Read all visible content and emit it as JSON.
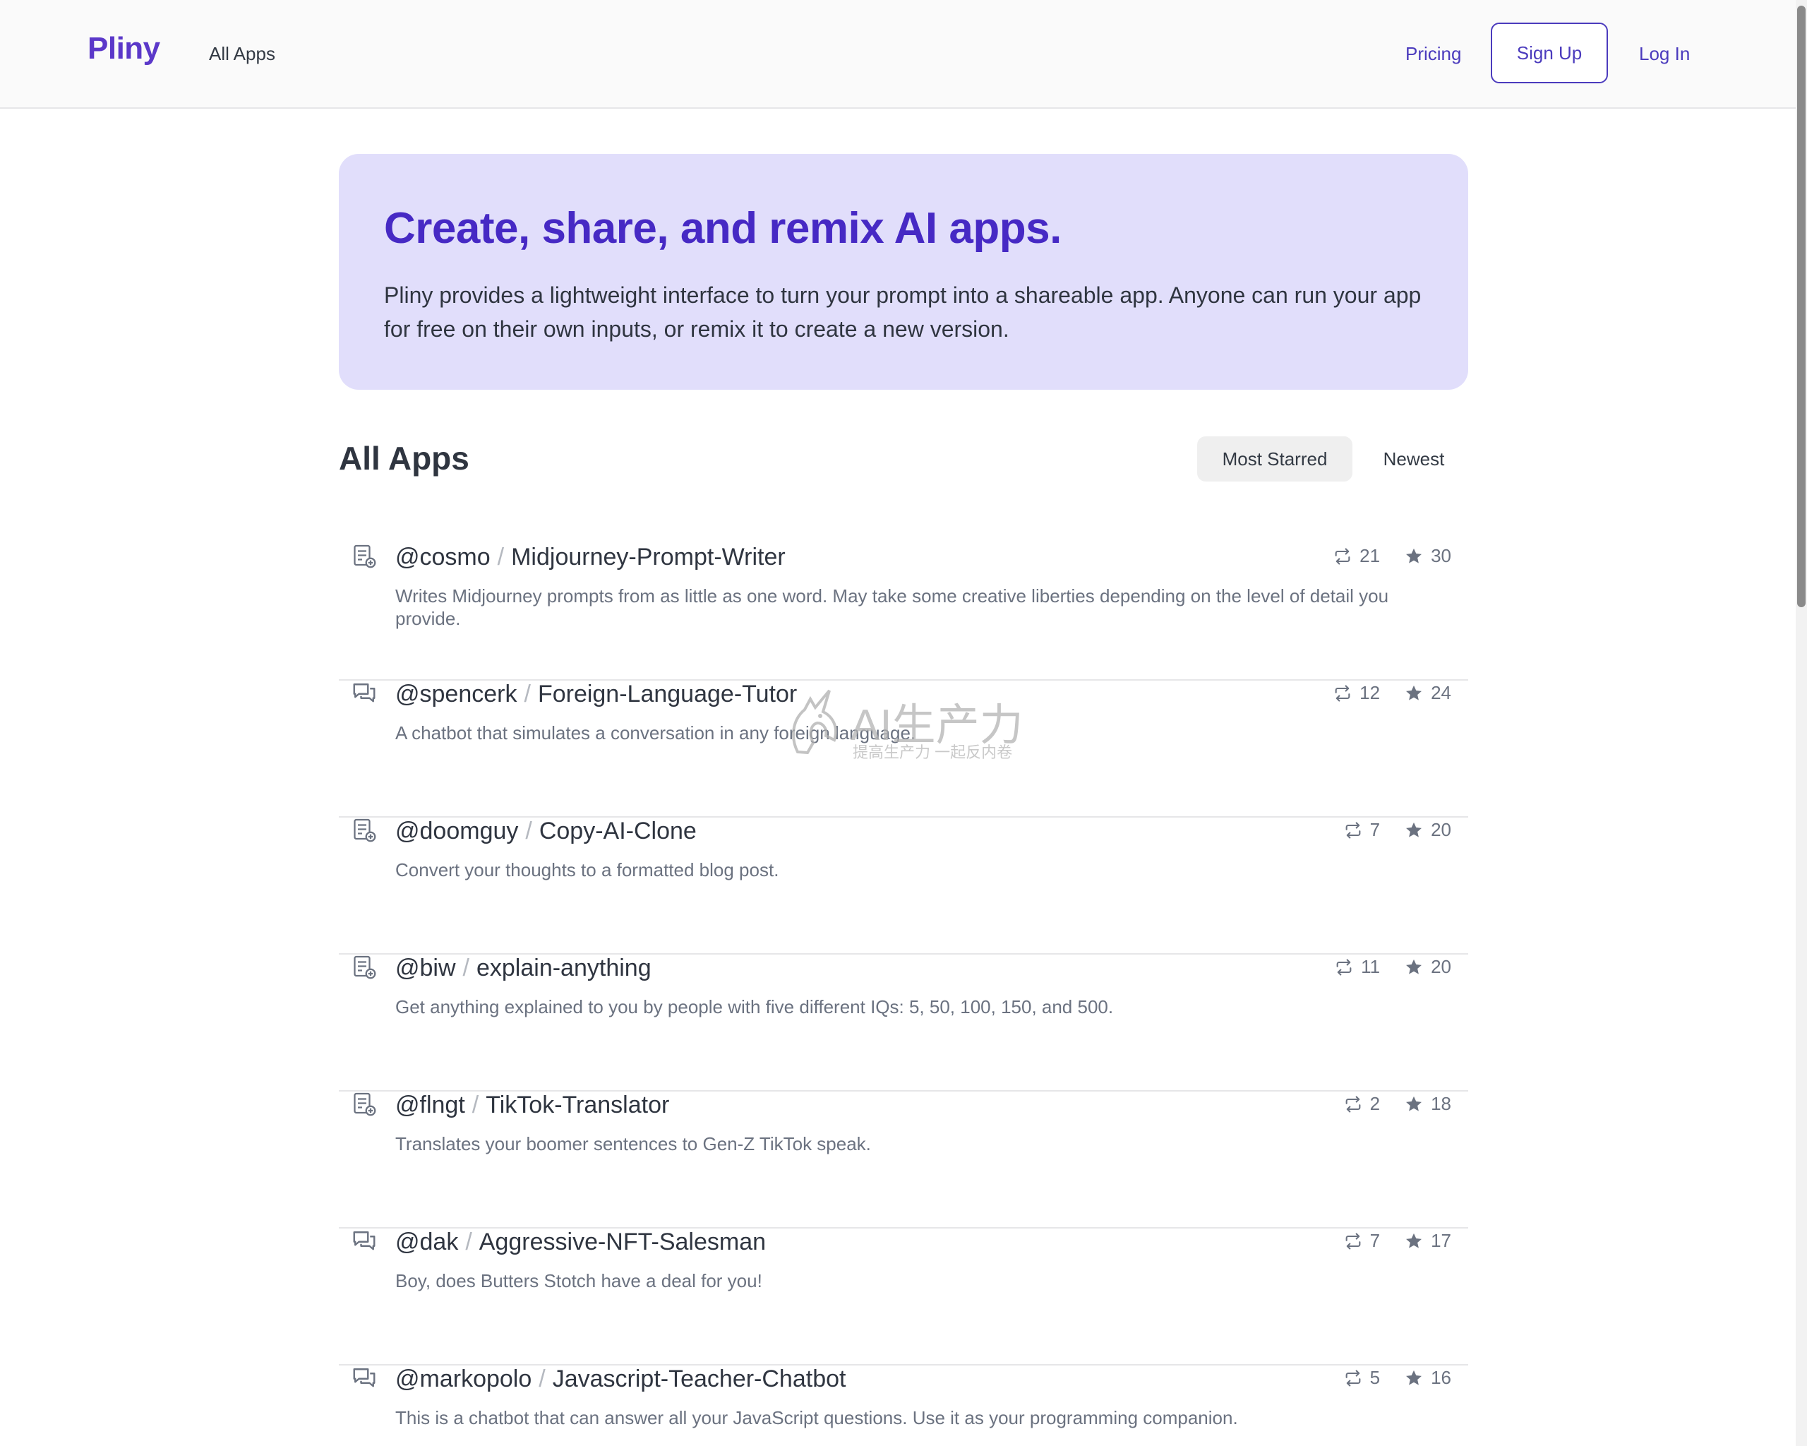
{
  "nav": {
    "brand": "Pliny",
    "all_apps": "All Apps",
    "pricing": "Pricing",
    "sign_up": "Sign Up",
    "log_in": "Log In"
  },
  "hero": {
    "title": "Create, share, and remix AI apps.",
    "description": "Pliny provides a lightweight interface to turn your prompt into a shareable app. Anyone can run your app for free on their own inputs, or remix it to create a new version."
  },
  "section": {
    "title": "All Apps",
    "sort_tabs": [
      "Most Starred",
      "Newest"
    ],
    "active_sort": "Most Starred"
  },
  "apps": [
    {
      "type": "document",
      "user": "@cosmo",
      "name": "Midjourney-Prompt-Writer",
      "description": "Writes Midjourney prompts from as little as one word. May take some creative liberties depending on the level of detail you provide.",
      "remixes": "21",
      "stars": "30"
    },
    {
      "type": "chat",
      "user": "@spencerk",
      "name": "Foreign-Language-Tutor",
      "description": "A chatbot that simulates a conversation in any foreign language.",
      "remixes": "12",
      "stars": "24"
    },
    {
      "type": "document",
      "user": "@doomguy",
      "name": "Copy-AI-Clone",
      "description": "Convert your thoughts to a formatted blog post.",
      "remixes": "7",
      "stars": "20"
    },
    {
      "type": "document",
      "user": "@biw",
      "name": "explain-anything",
      "description": "Get anything explained to you by people with five different IQs: 5, 50, 100, 150, and 500.",
      "remixes": "11",
      "stars": "20"
    },
    {
      "type": "document",
      "user": "@flngt",
      "name": "TikTok-Translator",
      "description": "Translates your boomer sentences to Gen-Z TikTok speak.",
      "remixes": "2",
      "stars": "18"
    },
    {
      "type": "chat",
      "user": "@dak",
      "name": "Aggressive-NFT-Salesman",
      "description": "Boy, does Butters Stotch have a deal for you!",
      "remixes": "7",
      "stars": "17"
    },
    {
      "type": "chat",
      "user": "@markopolo",
      "name": "Javascript-Teacher-Chatbot",
      "description": "This is a chatbot that can answer all your JavaScript questions. Use it as your programming companion.",
      "remixes": "5",
      "stars": "16"
    }
  ],
  "icons": {
    "document": "document-plus-icon",
    "chat": "chat-bubbles-icon",
    "remix": "remix-arrows-icon",
    "star": "star-icon"
  },
  "watermark": {
    "main": "AI生产力",
    "sub": "提高生产力 一起反内卷"
  },
  "colors": {
    "brand": "#5b38c9",
    "accent": "#4b3bbd",
    "hero_bg": "#e1defb",
    "hero_title": "#4629c4"
  }
}
